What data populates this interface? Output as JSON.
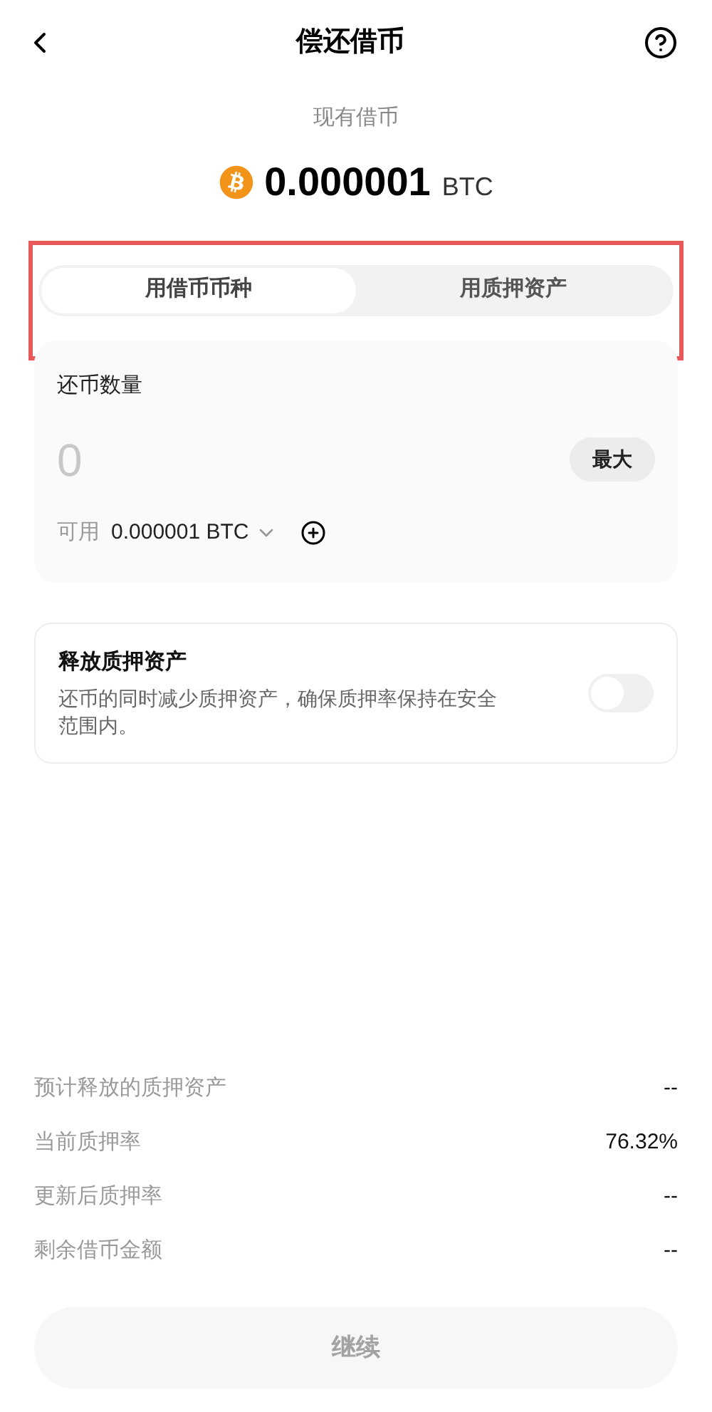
{
  "header": {
    "title": "偿还借币"
  },
  "balance": {
    "label": "现有借币",
    "amount": "0.000001",
    "unit": "BTC"
  },
  "mode_tabs": {
    "highlighted": true,
    "tabs": [
      {
        "label": "用借币币种",
        "selected": true
      },
      {
        "label": "用质押资产",
        "selected": false
      }
    ]
  },
  "repay": {
    "label": "还币数量",
    "placeholder": "0",
    "max_button": "最大",
    "available_label": "可用",
    "available_value": "0.000001 BTC"
  },
  "release": {
    "title": "释放质押资产",
    "description": "还币的同时减少质押资产，确保质押率保持在安全范围内。",
    "on": false
  },
  "summary": [
    {
      "label": "预计释放的质押资产",
      "value": "--"
    },
    {
      "label": "当前质押率",
      "value": "76.32%"
    },
    {
      "label": "更新后质押率",
      "value": "--"
    },
    {
      "label": "剩余借币金额",
      "value": "--"
    }
  ],
  "continue_button": {
    "label": "继续",
    "disabled": true
  }
}
